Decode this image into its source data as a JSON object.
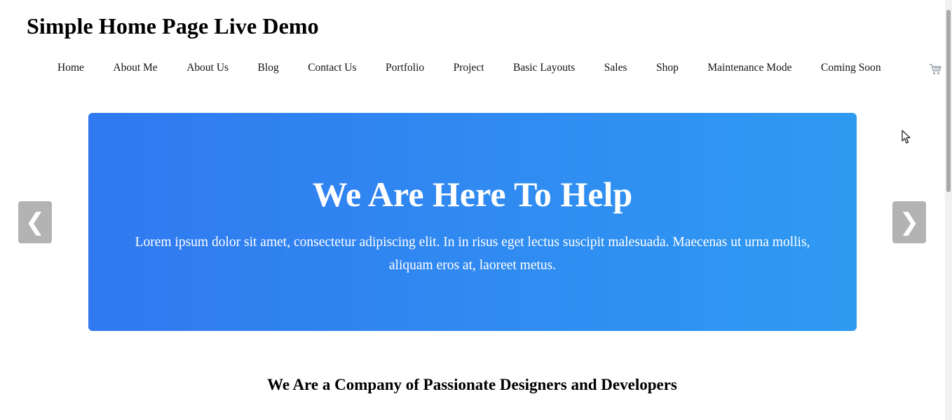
{
  "site": {
    "title": "Simple Home Page Live Demo"
  },
  "nav": {
    "items": [
      {
        "label": "Home"
      },
      {
        "label": "About Me"
      },
      {
        "label": "About Us"
      },
      {
        "label": "Blog"
      },
      {
        "label": "Contact Us"
      },
      {
        "label": "Portfolio"
      },
      {
        "label": "Project"
      },
      {
        "label": "Basic Layouts"
      },
      {
        "label": "Sales"
      },
      {
        "label": "Shop"
      },
      {
        "label": "Maintenance Mode"
      },
      {
        "label": "Coming Soon"
      }
    ],
    "cart_icon": "shopping-cart-icon"
  },
  "hero": {
    "heading": "We Are Here To Help",
    "text": "Lorem ipsum dolor sit amet, consectetur adipiscing elit. In in risus eget lectus suscipit malesuada. Maecenas ut urna mollis, aliquam eros at, laoreet metus.",
    "gradient_start": "#3079f0",
    "gradient_end": "#2f9af2",
    "prev_arrow": "❮",
    "next_arrow": "❯"
  },
  "section": {
    "heading": "We Are a Company of Passionate Designers and Developers"
  }
}
